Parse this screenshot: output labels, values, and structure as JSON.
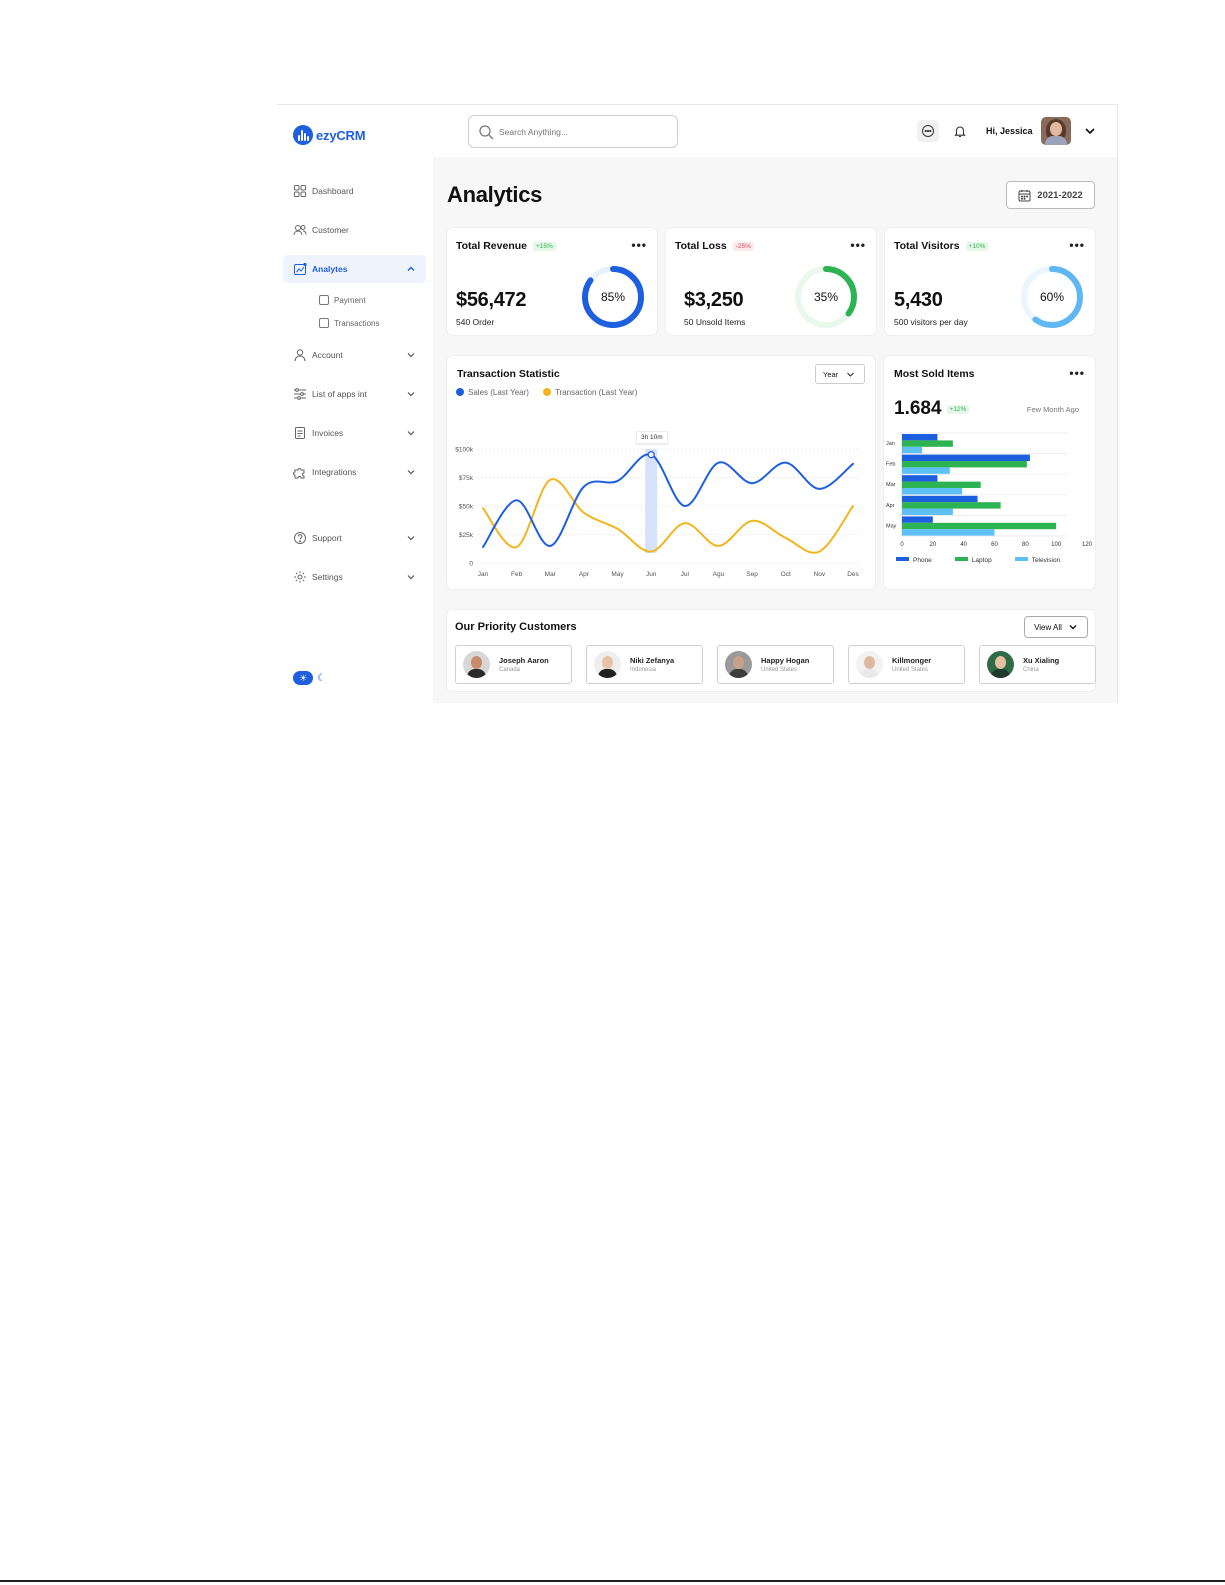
{
  "app": {
    "name": "ezyCRM"
  },
  "search": {
    "placeholder": "Search Anything..."
  },
  "header": {
    "greeting": "Hi, Jessica"
  },
  "sidebar": {
    "items": [
      {
        "label": "Dashboard",
        "icon": "grid-icon"
      },
      {
        "label": "Customer",
        "icon": "users-icon"
      },
      {
        "label": "Analytes",
        "icon": "chart-icon",
        "active": true
      },
      {
        "label": "Account",
        "icon": "user-icon"
      },
      {
        "label": "List of apps int",
        "icon": "sliders-icon"
      },
      {
        "label": "Invoices",
        "icon": "invoice-icon"
      },
      {
        "label": "Integrations",
        "icon": "puzzle-icon"
      },
      {
        "label": "Support",
        "icon": "help-icon"
      },
      {
        "label": "Settings",
        "icon": "gear-icon"
      }
    ],
    "subitems": [
      "Payment",
      "Transactions"
    ]
  },
  "page": {
    "title": "Analytics",
    "date_range": "2021-2022"
  },
  "stats": [
    {
      "title": "Total Revenue",
      "change": "+15%",
      "trend": "up",
      "value": "$56,472",
      "sub": "540 Order",
      "percent": 85,
      "percent_label": "85%",
      "color": "#1e5fe0"
    },
    {
      "title": "Total Loss",
      "change": "-25%",
      "trend": "down",
      "value": "$3,250",
      "sub": "50 Unsold Items",
      "percent": 35,
      "percent_label": "35%",
      "color": "#2eb352"
    },
    {
      "title": "Total Visitors",
      "change": "+10%",
      "trend": "up",
      "value": "5,430",
      "sub": "500 visitors per day",
      "percent": 60,
      "percent_label": "60%",
      "color": "#5fb8f3"
    }
  ],
  "transaction": {
    "title": "Transaction Statistic",
    "period": "Year",
    "tooltip": "3h 10m",
    "legend": [
      {
        "label": "Sales (Last Year)",
        "color": "#1e5fe0"
      },
      {
        "label": "Transaction (Last Year)",
        "color": "#f2b51d"
      }
    ]
  },
  "most_sold": {
    "title": "Most Sold Items",
    "value": "1.684",
    "change": "+12%",
    "range": "Few Month Ago"
  },
  "customers": {
    "title": "Our Priority Customers",
    "view_all": "View All",
    "list": [
      {
        "name": "Joseph Aaron",
        "country": "Canada",
        "skin": "#c98b6a",
        "shirt": "#2a2a2a",
        "bg": "#d7d7d7"
      },
      {
        "name": "Niki Zefanya",
        "country": "Indonesia",
        "skin": "#e8c2a8",
        "shirt": "#222222",
        "bg": "#eeeeee"
      },
      {
        "name": "Happy Hogan",
        "country": "United States",
        "skin": "#c9a08a",
        "shirt": "#3d3d3d",
        "bg": "#9a9a9a"
      },
      {
        "name": "Killmonger",
        "country": "United States",
        "skin": "#e0b8a0",
        "shirt": "#e9e9e9",
        "bg": "#f2f2f2"
      },
      {
        "name": "Xu Xialing",
        "country": "China",
        "skin": "#e6c09f",
        "shirt": "#1f3a2c",
        "bg": "#2e6b49"
      }
    ]
  },
  "chart_data": [
    {
      "type": "line",
      "title": "Transaction Statistic",
      "categories": [
        "Jan",
        "Feb",
        "Mar",
        "Apr",
        "May",
        "Jun",
        "Jul",
        "Agu",
        "Sep",
        "Oct",
        "Nov",
        "Des"
      ],
      "ytick_labels": [
        "0",
        "$25k",
        "$50k",
        "$75k",
        "$100k"
      ],
      "ylim": [
        0,
        100000
      ],
      "series": [
        {
          "name": "Sales (Last Year)",
          "color": "#1e5fe0",
          "values": [
            14000,
            55000,
            15000,
            67000,
            72000,
            95000,
            50000,
            88000,
            70000,
            88000,
            65000,
            87000
          ]
        },
        {
          "name": "Transaction (Last Year)",
          "color": "#f2b51d",
          "values": [
            48000,
            14000,
            73000,
            44000,
            30000,
            10000,
            35000,
            15000,
            37000,
            22000,
            10000,
            50000
          ]
        }
      ]
    },
    {
      "type": "bar",
      "orientation": "horizontal",
      "title": "Most Sold Items",
      "categories": [
        "Jan",
        "Feb",
        "Mar",
        "Apr",
        "May"
      ],
      "xtick_labels": [
        "0",
        "20",
        "40",
        "60",
        "80",
        "100",
        "120"
      ],
      "xlim": [
        0,
        120
      ],
      "series": [
        {
          "name": "Phone",
          "color": "#1e5fe0",
          "values": [
            23,
            83,
            23,
            49,
            20
          ]
        },
        {
          "name": "Laptop",
          "color": "#2eb352",
          "values": [
            33,
            81,
            51,
            64,
            100
          ]
        },
        {
          "name": "Television",
          "color": "#5fc0f5",
          "values": [
            13,
            31,
            39,
            33,
            60
          ]
        }
      ]
    }
  ]
}
